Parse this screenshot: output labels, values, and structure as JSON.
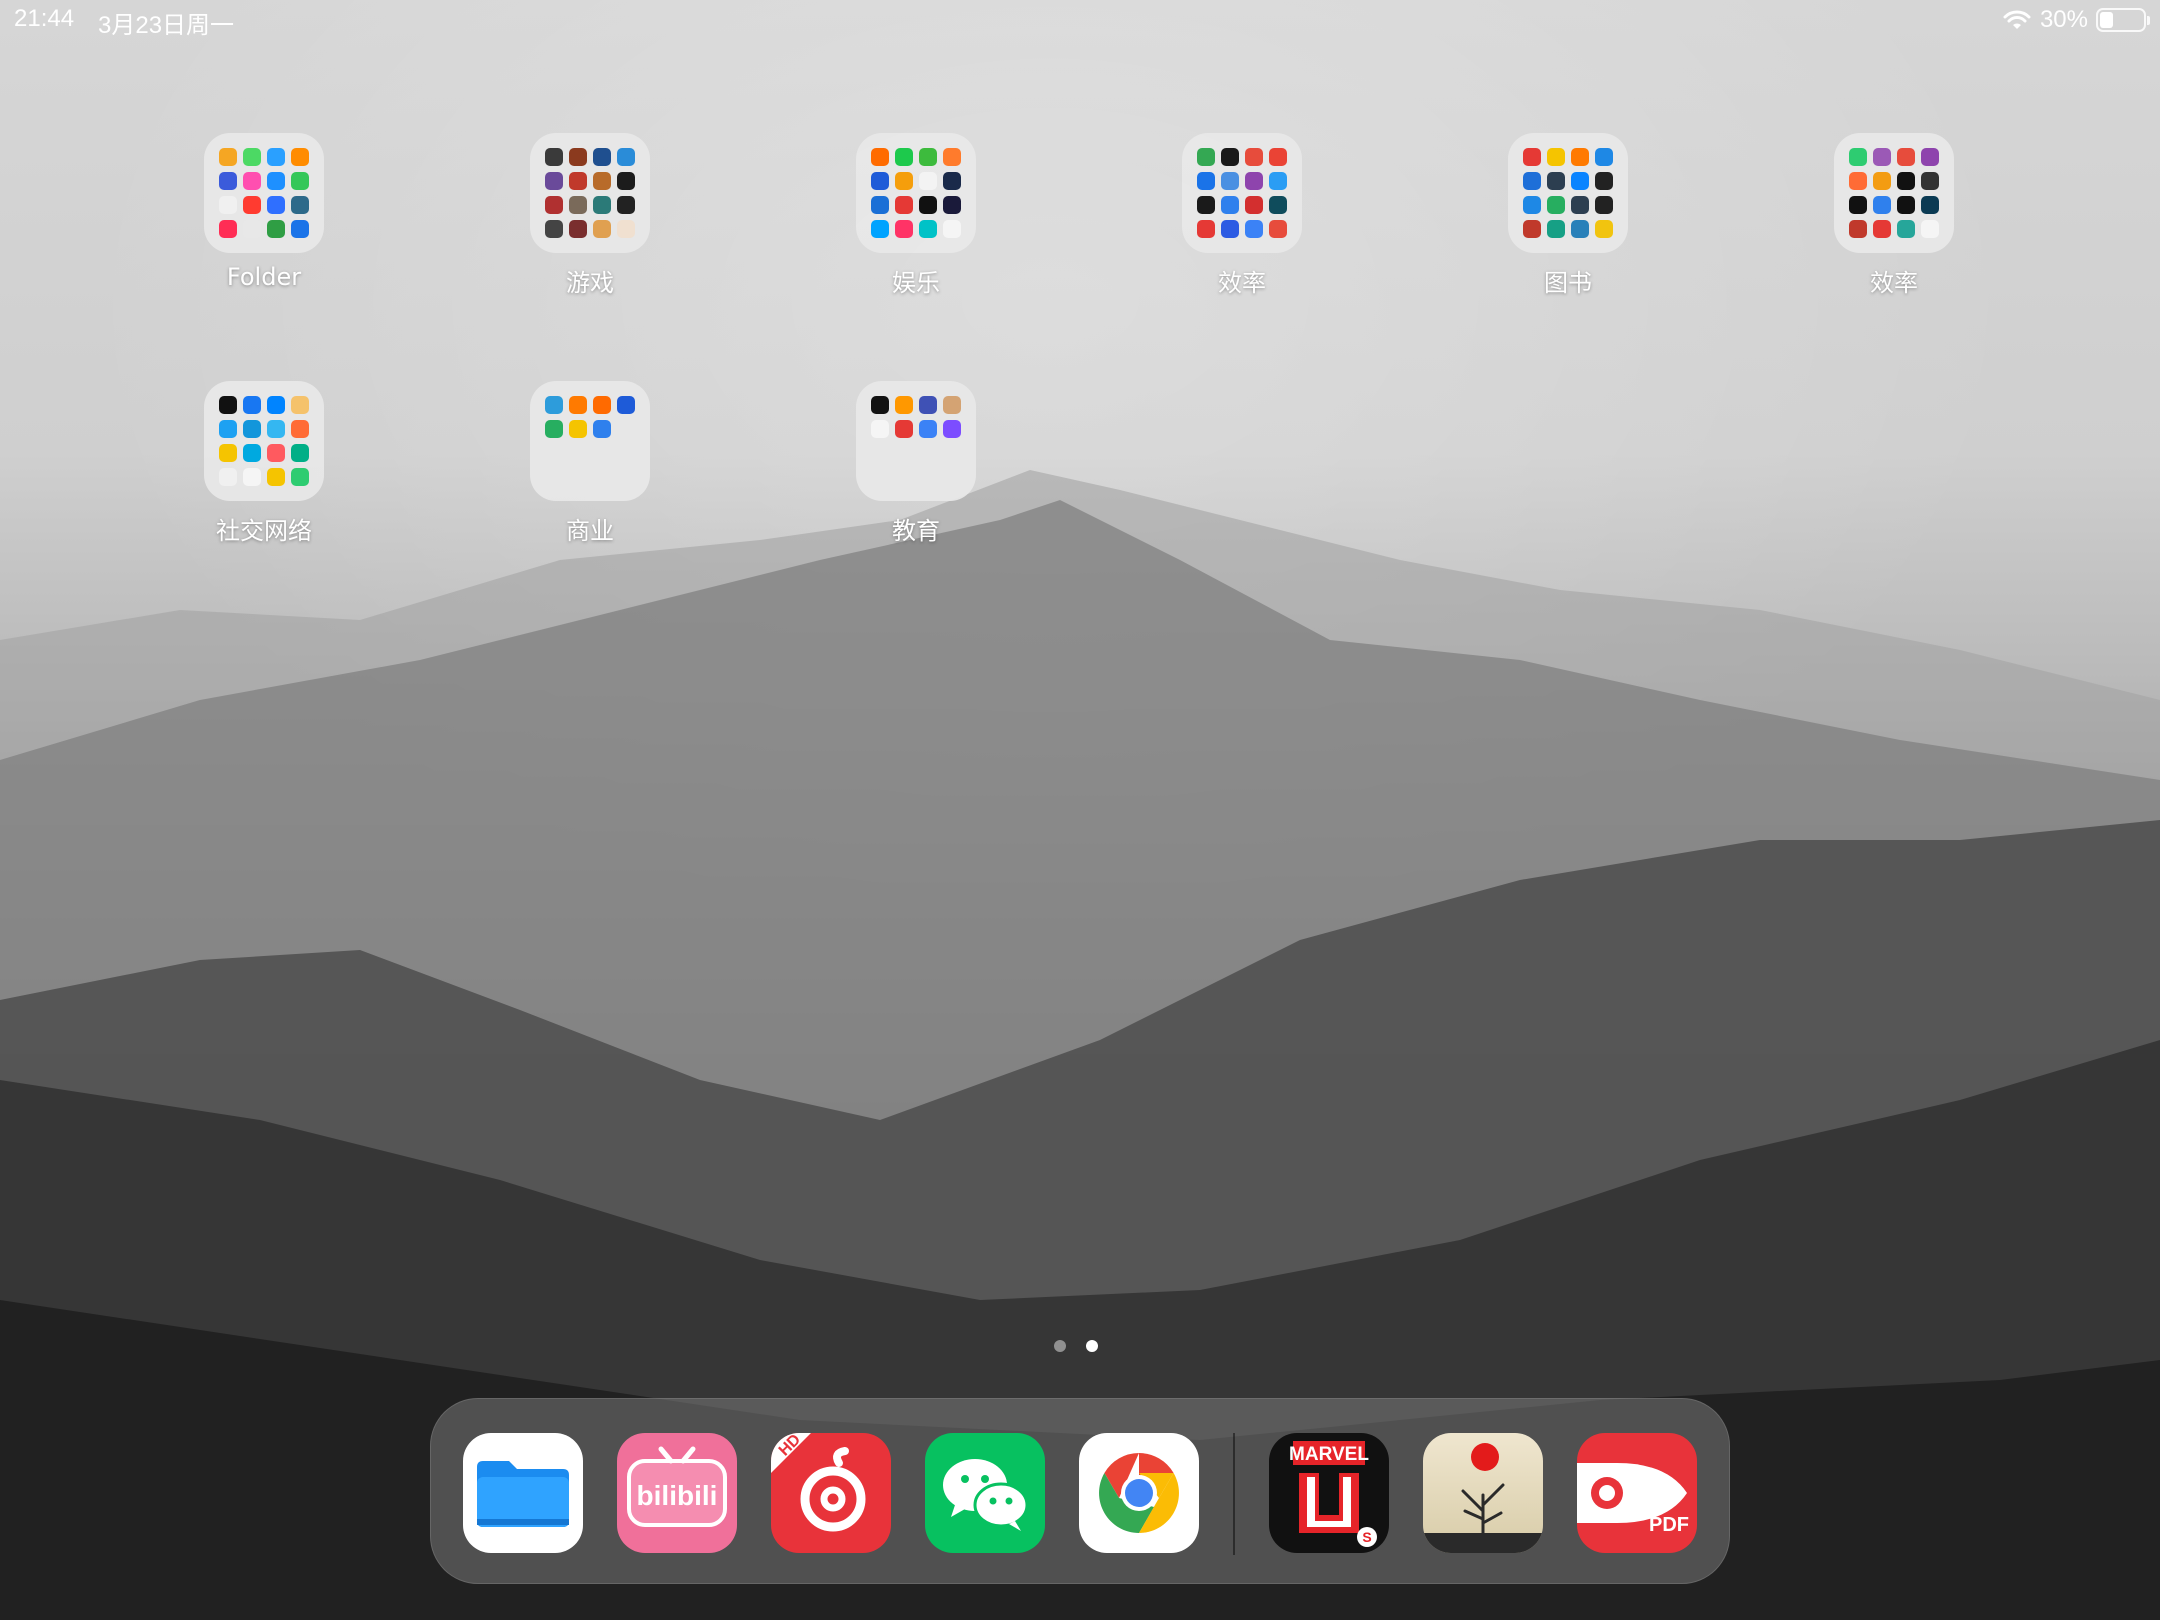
{
  "status_bar": {
    "time": "21:44",
    "date": "3月23日周一",
    "battery_percent": "30%",
    "battery_level": 0.3,
    "wifi_icon": "wifi-icon",
    "battery_icon": "battery-icon"
  },
  "folders": [
    {
      "label": "Folder",
      "colors": [
        "#f5a623",
        "#4cd964",
        "#2aa0ff",
        "#ff8c00",
        "#3b5bdb",
        "#ff4fb0",
        "#1e90ff",
        "#34c759",
        "#f0f0f0",
        "#ff3b30",
        "#2f6fff",
        "#2d6a8a",
        "#ff2d55",
        "#e8e8e8",
        "#2f9e44",
        "#1a73e8"
      ]
    },
    {
      "label": "游戏",
      "colors": [
        "#3a3a3a",
        "#8b3a1e",
        "#1f4f8f",
        "#2a8cd8",
        "#6a4a9a",
        "#c0392b",
        "#b86b2a",
        "#1c1c1c",
        "#b03030",
        "#7a6a5a",
        "#2b7a78",
        "#222222",
        "#444444",
        "#7a2e2e",
        "#e0a050",
        "#f0e0d0"
      ]
    },
    {
      "label": "娱乐",
      "colors": [
        "#ff6b00",
        "#1dc94c",
        "#3dbb3d",
        "#ff7b2c",
        "#1e5bd8",
        "#f59e0b",
        "#f3f3f3",
        "#1a2a4a",
        "#1a6fd6",
        "#e53935",
        "#111111",
        "#1a1a3a",
        "#00a3ff",
        "#ff3366",
        "#00c2c7",
        "#f5f5f5"
      ]
    },
    {
      "label": "效率",
      "colors": [
        "#34a853",
        "#1a1a1a",
        "#e74c3c",
        "#ea4335",
        "#1a73e8",
        "#4a90e2",
        "#8e44ad",
        "#2a9df4",
        "#1a1a1a",
        "#2f80ed",
        "#d32f2f",
        "#0f4c5c",
        "#e53935",
        "#2d5be3",
        "#3b82f6",
        "#e74c3c"
      ]
    },
    {
      "label": "图书",
      "colors": [
        "#e53935",
        "#f5c400",
        "#ff7a00",
        "#1e88e5",
        "#1e6fd8",
        "#2c3e50",
        "#0a84ff",
        "#222222",
        "#1e88e5",
        "#27ae60",
        "#2c3e50",
        "#222222",
        "#c0392b",
        "#16a085",
        "#2980b9",
        "#f1c40f"
      ]
    },
    {
      "label": "效率",
      "colors": [
        "#2ecc71",
        "#9b59b6",
        "#e74c3c",
        "#8e44ad",
        "#ff6b35",
        "#f39c12",
        "#111111",
        "#333333",
        "#111111",
        "#2f80ed",
        "#111111",
        "#0b3a53",
        "#c0392b",
        "#e53935",
        "#26a69a",
        "#f5f5f5"
      ]
    },
    {
      "label": "社交网络",
      "colors": [
        "#111111",
        "#1877f2",
        "#0084ff",
        "#f5c26b",
        "#1da1f2",
        "#1296db",
        "#34b7f1",
        "#ff6b35",
        "#f5c400",
        "#00a9e0",
        "#ff5a5f",
        "#00af87",
        "#f0f0f0",
        "#f5f5f5",
        "#f5c400",
        "#2ecc71"
      ]
    },
    {
      "label": "商业",
      "colors": [
        "#2d9cdb",
        "#ff7a00",
        "#ff6a00",
        "#1e5bd8",
        "#27ae60",
        "#f5c400",
        "#2f80ed"
      ]
    },
    {
      "label": "教育",
      "colors": [
        "#111111",
        "#ff9800",
        "#3f51b5",
        "#d4a373",
        "#f5f5f5",
        "#e53935",
        "#3b82f6",
        "#7c4dff"
      ]
    }
  ],
  "page_indicator": {
    "count": 2,
    "active": 2
  },
  "dock": {
    "apps": [
      {
        "name": "files-app-icon"
      },
      {
        "name": "bilibili-app-icon",
        "text": "bilibili"
      },
      {
        "name": "netease-music-app-icon",
        "badge": "HD"
      },
      {
        "name": "wechat-app-icon"
      },
      {
        "name": "chrome-app-icon"
      },
      {
        "name": "marvel-unlimited-app-icon",
        "text": "MARVEL"
      },
      {
        "name": "tree-sunset-app-icon"
      },
      {
        "name": "pdf-expert-app-icon",
        "text": "PDF"
      }
    ]
  }
}
